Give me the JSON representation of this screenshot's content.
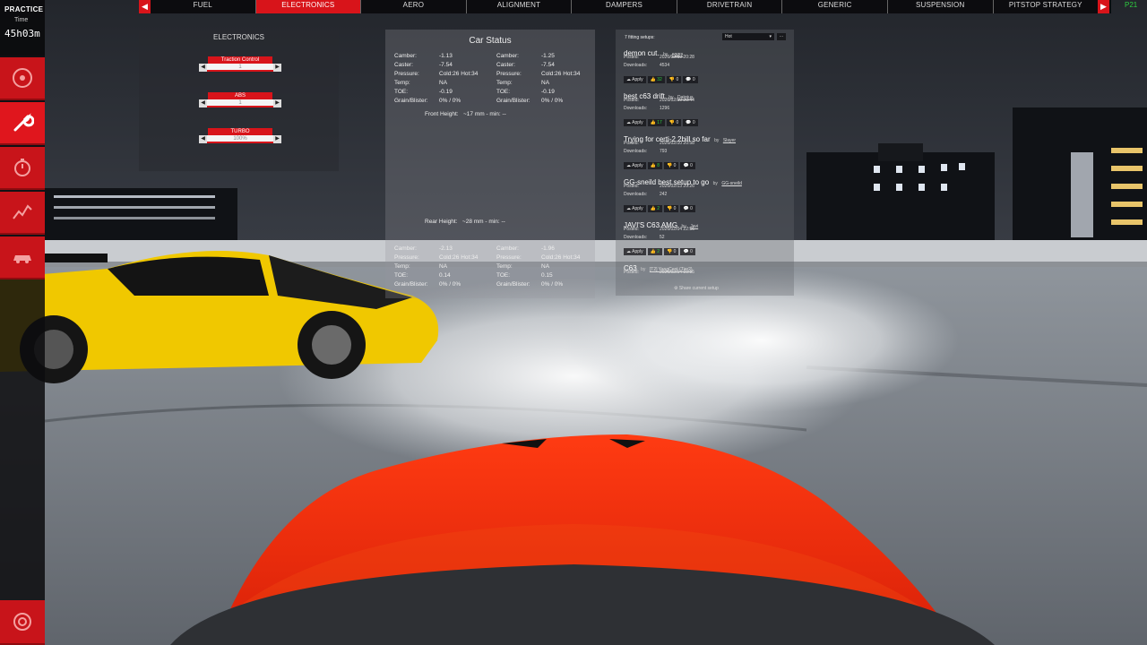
{
  "session": {
    "mode": "PRACTICE",
    "time_label": "Time",
    "time_value": "45h03m"
  },
  "top_nav": {
    "tabs": [
      "FUEL",
      "ELECTRONICS",
      "AERO",
      "ALIGNMENT",
      "DAMPERS",
      "DRIVETRAIN",
      "GENERIC",
      "SUSPENSION",
      "PITSTOP STRATEGY"
    ],
    "active_tab": "ELECTRONICS",
    "position": "P21"
  },
  "electronics": {
    "title": "ELECTRONICS",
    "traction_control": {
      "label": "Traction Control",
      "value": "1"
    },
    "abs": {
      "label": "ABS",
      "value": "1"
    },
    "turbo": {
      "label": "TURBO",
      "value": "100%"
    }
  },
  "car_status": {
    "title": "Car Status",
    "labels": {
      "camber": "Camber:",
      "caster": "Caster:",
      "pressure": "Pressure:",
      "temp": "Temp:",
      "toe": "TOE:",
      "grain": "Grain/Blister:"
    },
    "fl": {
      "camber": "-1.13",
      "caster": "-7.54",
      "pressure": "Cold:26 Hot:34",
      "temp": "NA",
      "toe": "-0.19",
      "grain": "0% / 0%"
    },
    "fr": {
      "camber": "-1.25",
      "caster": "-7.54",
      "pressure": "Cold:26 Hot:34",
      "temp": "NA",
      "toe": "-0.19",
      "grain": "0% / 0%"
    },
    "front_height": {
      "label": "Front Height:",
      "value": "~17 mm - min: --"
    },
    "rear_height": {
      "label": "Rear Height:",
      "value": "~28 mm - min: --"
    },
    "rl": {
      "camber": "-2.13",
      "pressure": "Cold:26 Hot:34",
      "temp": "NA",
      "toe": "0.14",
      "grain": "0% / 0%"
    },
    "rr": {
      "camber": "-1.96",
      "pressure": "Cold:26 Hot:34",
      "temp": "NA",
      "toe": "0.15",
      "grain": "0% / 0%"
    }
  },
  "setups": {
    "count_label": "7 fitting setups:",
    "sort": "Hot",
    "more": "...",
    "by_label": "by",
    "posted_label": "Posted:",
    "downloads_label": "Downloads:",
    "apply_label": "Apply",
    "entries": [
      {
        "title": "demon cut.",
        "author": "eggrs",
        "posted": "2026/02/10 20:28",
        "downloads": "4534",
        "likes": "32",
        "dislikes": "0",
        "comments": "0"
      },
      {
        "title": "best c63 drift",
        "author": "Datrrius",
        "posted": "2026/02/10 20:44",
        "downloads": "1296",
        "likes": "17",
        "dislikes": "0",
        "comments": "0"
      },
      {
        "title": "Trying for certi-2.2bill so far",
        "author": "Slayer",
        "posted": "2026/02/10 20:58",
        "downloads": "793",
        "likes": "8",
        "dislikes": "0",
        "comments": "0"
      },
      {
        "title": "GG-sneild best setup to go",
        "author": "GG-sneild",
        "posted": "2026/02/13 20:26",
        "downloads": "242",
        "likes": "2",
        "dislikes": "0",
        "comments": "0"
      },
      {
        "title": "JAVI'S C63 AMG",
        "author": "Javi",
        "posted": "2026/02/04 22:56",
        "downloads": "52",
        "likes": "2",
        "dislikes": "0",
        "comments": "0"
      },
      {
        "title": "C63",
        "author": "[T2] YangCent (Tier2)",
        "posted": "2026/02/14 10:15",
        "downloads": "",
        "likes": "",
        "dislikes": "",
        "comments": ""
      }
    ],
    "share_label": "Share current setup"
  }
}
